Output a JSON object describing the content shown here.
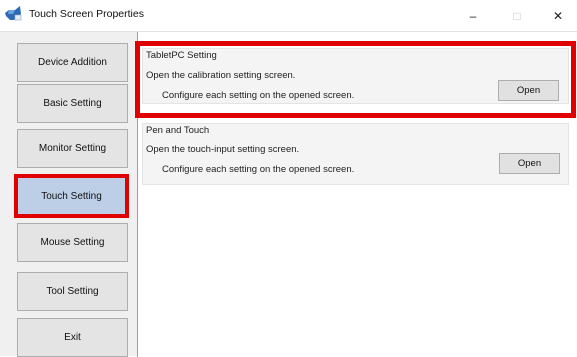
{
  "window": {
    "title": "Touch Screen Properties",
    "controls": {
      "minimize": "–",
      "maximize": "□",
      "close": "✕"
    }
  },
  "sidebar": {
    "items": [
      {
        "label": "Device Addition"
      },
      {
        "label": "Basic Setting"
      },
      {
        "label": "Monitor Setting"
      },
      {
        "label": "Touch Setting"
      },
      {
        "label": "Mouse Setting"
      },
      {
        "label": "Tool Setting"
      },
      {
        "label": "Exit"
      }
    ],
    "selected": "Touch Setting"
  },
  "panel": {
    "groups": [
      {
        "title": "TabletPC Setting",
        "description": "Open the calibration setting screen.",
        "subtext": "Configure each setting on the opened screen.",
        "button": "Open"
      },
      {
        "title": "Pen and Touch",
        "description": "Open the touch-input setting screen.",
        "subtext": "Configure each setting on the opened screen.",
        "button": "Open"
      }
    ]
  },
  "colors": {
    "highlight": "#e00000",
    "selected_nav": "#bccfe6"
  },
  "icons": {
    "app": "touch-screen-app-icon"
  }
}
